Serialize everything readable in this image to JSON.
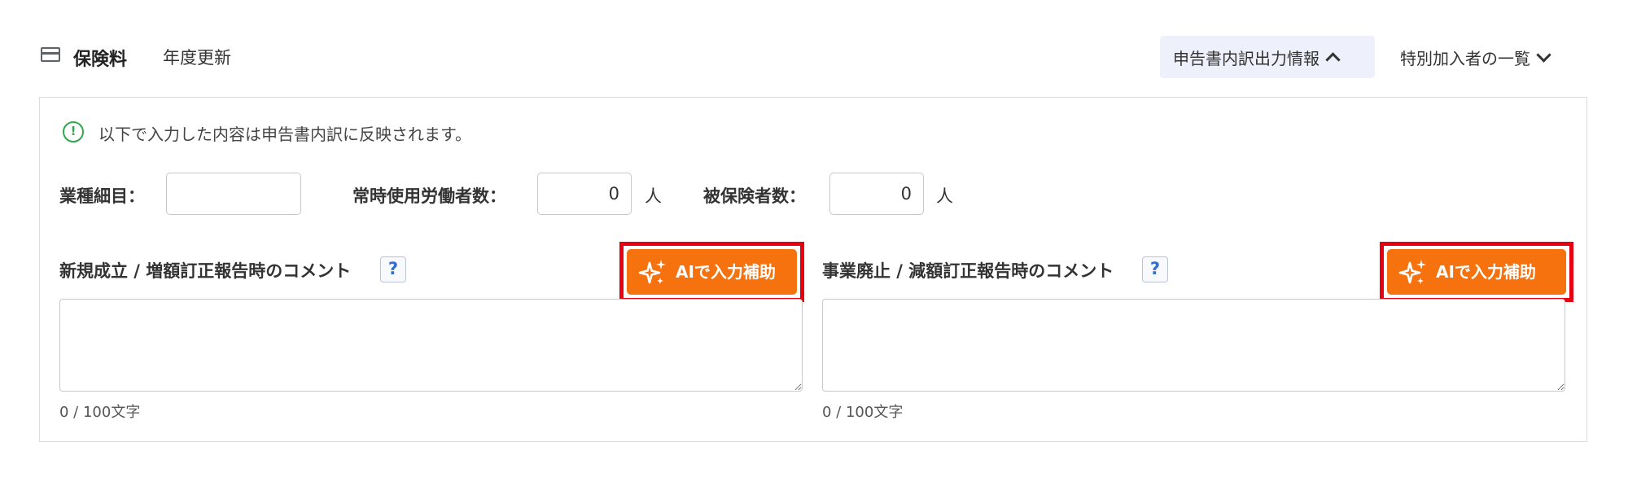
{
  "header": {
    "icon": "credit-card-icon",
    "title": "保険料",
    "update_link": "年度更新",
    "output_toggle": "申告書内訳出力情報",
    "special_toggle": "特別加入者の一覧"
  },
  "notice": {
    "icon": "info-circle-icon",
    "text": "以下で入力した内容は申告書内訳に反映されます。"
  },
  "fields": {
    "industry": {
      "label": "業種細目：",
      "value": ""
    },
    "workers": {
      "label": "常時使用労働者数：",
      "value": "0",
      "unit": "人"
    },
    "insured": {
      "label": "被保険者数：",
      "value": "0",
      "unit": "人"
    }
  },
  "comments": {
    "left": {
      "label": "新規成立 / 増額訂正報告時のコメント",
      "help": "?",
      "ai_button": "AIで入力補助",
      "value": "",
      "counter": "0 / 100文字"
    },
    "right": {
      "label": "事業廃止 / 減額訂正報告時のコメント",
      "help": "?",
      "ai_button": "AIで入力補助",
      "value": "",
      "counter": "0 / 100文字"
    }
  },
  "colors": {
    "ai_button": "#f5720f",
    "highlight_frame": "#e60012",
    "notice_icon": "#2fa84f",
    "toggle_bg": "#eef0fb"
  }
}
